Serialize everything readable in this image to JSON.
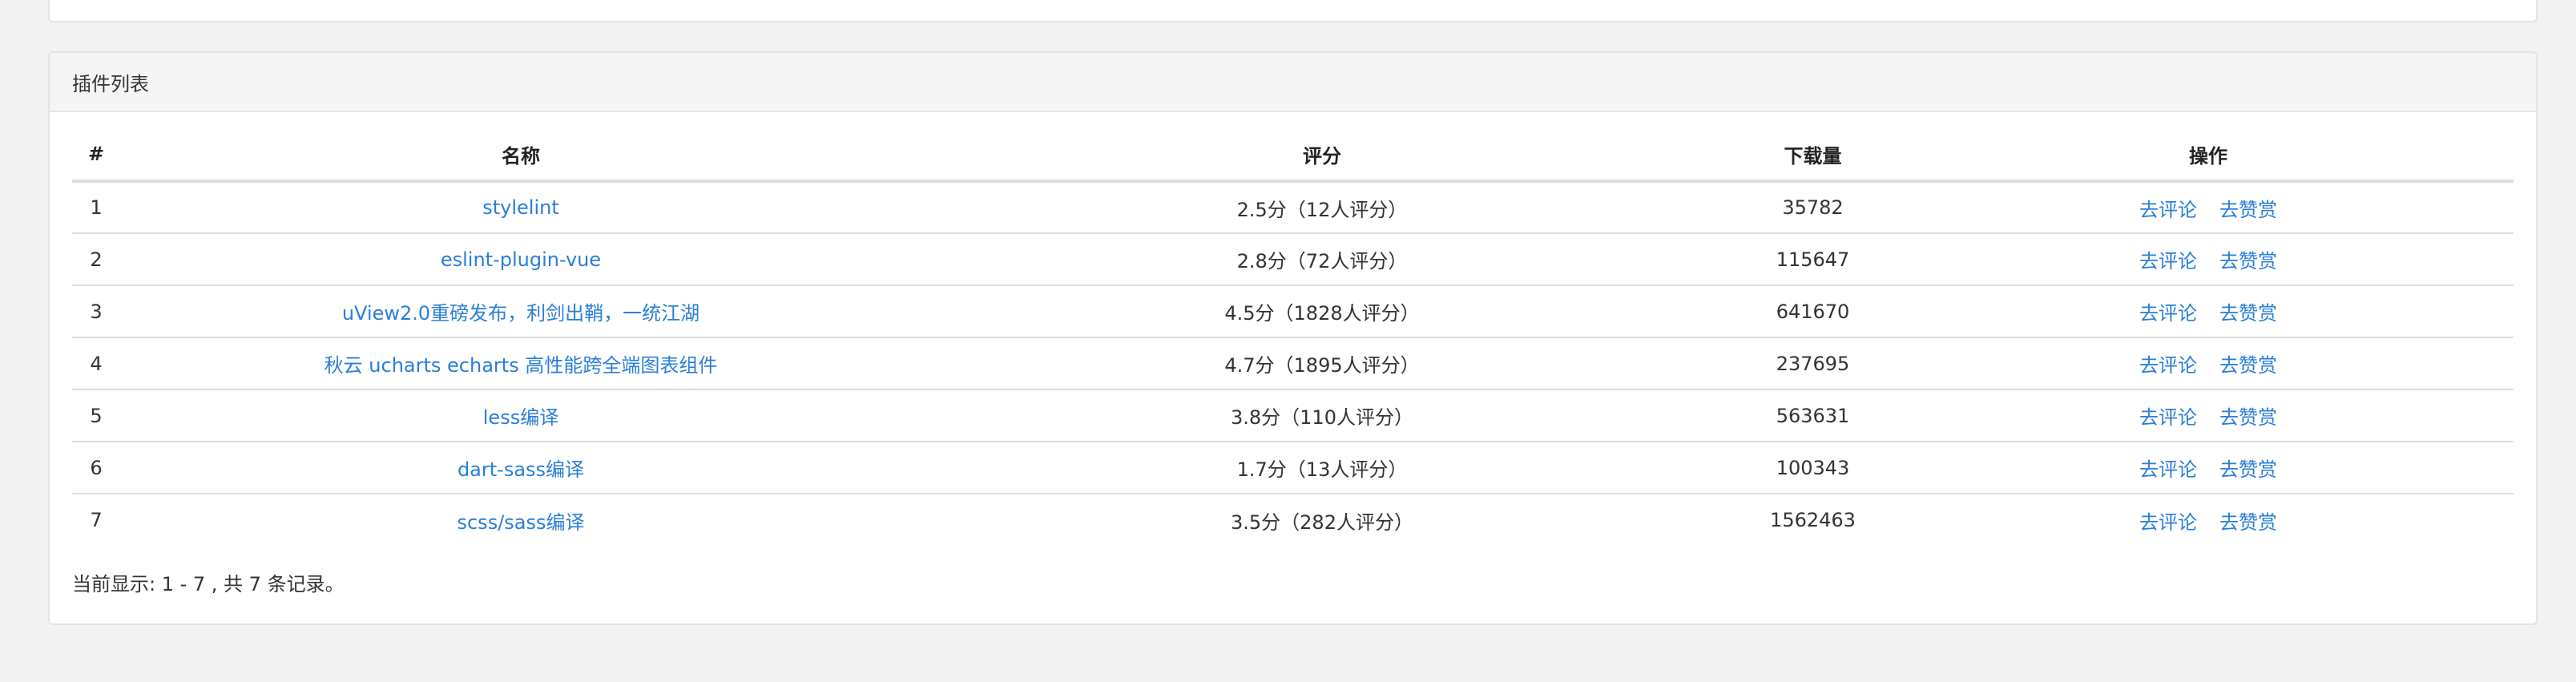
{
  "panel": {
    "title": "插件列表"
  },
  "table": {
    "headers": {
      "index": "#",
      "name": "名称",
      "rating": "评分",
      "downloads": "下载量",
      "actions": "操作"
    },
    "rows": [
      {
        "index": "1",
        "name": "stylelint",
        "rating": "2.5分（12人评分）",
        "downloads": "35782",
        "review": "去评论",
        "reward": "去赞赏"
      },
      {
        "index": "2",
        "name": "eslint-plugin-vue",
        "rating": "2.8分（72人评分）",
        "downloads": "115647",
        "review": "去评论",
        "reward": "去赞赏"
      },
      {
        "index": "3",
        "name": "uView2.0重磅发布，利剑出鞘，一统江湖",
        "rating": "4.5分（1828人评分）",
        "downloads": "641670",
        "review": "去评论",
        "reward": "去赞赏"
      },
      {
        "index": "4",
        "name": "秋云 ucharts echarts 高性能跨全端图表组件",
        "rating": "4.7分（1895人评分）",
        "downloads": "237695",
        "review": "去评论",
        "reward": "去赞赏"
      },
      {
        "index": "5",
        "name": "less编译",
        "rating": "3.8分（110人评分）",
        "downloads": "563631",
        "review": "去评论",
        "reward": "去赞赏"
      },
      {
        "index": "6",
        "name": "dart-sass编译",
        "rating": "1.7分（13人评分）",
        "downloads": "100343",
        "review": "去评论",
        "reward": "去赞赏"
      },
      {
        "index": "7",
        "name": "scss/sass编译",
        "rating": "3.5分（282人评分）",
        "downloads": "1562463",
        "review": "去评论",
        "reward": "去赞赏"
      }
    ]
  },
  "summary": "当前显示: 1 - 7 , 共 7 条记录。",
  "colors": {
    "link": "#2a7ed8",
    "heading_bg": "#f5f5f5",
    "page_bg": "#f3f3f4"
  }
}
